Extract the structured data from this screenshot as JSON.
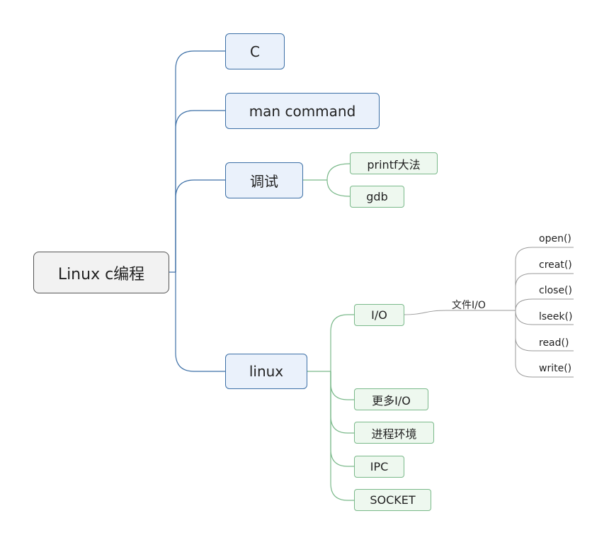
{
  "mindmap": {
    "root": "Linux c编程",
    "branches": [
      {
        "label": "C"
      },
      {
        "label": "man command"
      },
      {
        "label": "调试",
        "children": [
          "printf大法",
          "gdb"
        ]
      },
      {
        "label": "linux",
        "children": [
          "I/O",
          "更多I/O",
          "进程环境",
          "IPC",
          "SOCKET"
        ]
      }
    ],
    "io": {
      "label": "文件I/O",
      "functions": [
        "open()",
        "creat()",
        "close()",
        "lseek()",
        "read()",
        "write()"
      ]
    }
  },
  "colors": {
    "root_border": "#555555",
    "level1_border": "#3c6fa6",
    "level1_fill": "#eaf1fb",
    "level2_border": "#7ab98a",
    "level2_fill": "#eef8ef",
    "leaf_line": "#9a9a9a"
  }
}
